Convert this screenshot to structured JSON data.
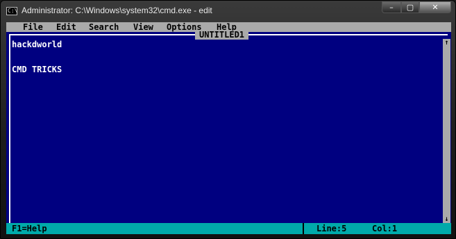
{
  "window": {
    "title": "Administrator: C:\\Windows\\system32\\cmd.exe - edit",
    "icon_text": "C:\\",
    "controls": {
      "minimize": "–",
      "maximize": "▢",
      "close": "✕"
    }
  },
  "menu": [
    {
      "label": "File"
    },
    {
      "label": "Edit"
    },
    {
      "label": "Search"
    },
    {
      "label": "View"
    },
    {
      "label": "Options"
    },
    {
      "label": "Help"
    }
  ],
  "document": {
    "title": "UNTITLED1",
    "lines": [
      "hackdworld",
      "",
      "CMD TRICKS"
    ]
  },
  "scrollbar": {
    "up_arrow": "↑",
    "down_arrow": "↓"
  },
  "status": {
    "help": "F1=Help",
    "line": "Line:5",
    "col": "Col:1"
  },
  "colors": {
    "editor_bg": "#000080",
    "menu_bg": "#aaaaaa",
    "status_bg": "#00aaaa",
    "text": "#ffffff"
  }
}
